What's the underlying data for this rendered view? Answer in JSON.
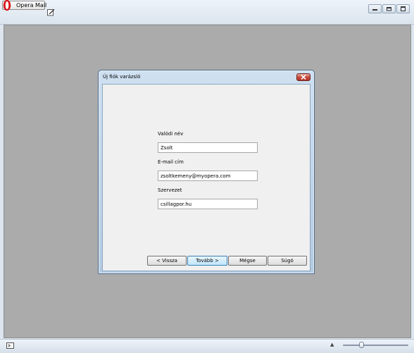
{
  "app": {
    "menu_button_label": "Opera Mail"
  },
  "dialog": {
    "title": "Új fiók varázsló",
    "fields": [
      {
        "label": "Valódi név",
        "value": "Zsolt"
      },
      {
        "label": "E-mail cím",
        "value": "zsoltkemeny@myopera.com"
      },
      {
        "label": "Szervezet",
        "value": "csillagpor.hu"
      }
    ],
    "buttons": {
      "back": "< Vissza",
      "next": "Tovább >",
      "cancel": "Mégse",
      "help": "Súgó"
    }
  },
  "statusbar": {
    "zoom_level": 0.28
  },
  "colors": {
    "workspace_bg": "#ababab",
    "close_button": "#c4463a",
    "primary_button": "#bee6fd"
  }
}
